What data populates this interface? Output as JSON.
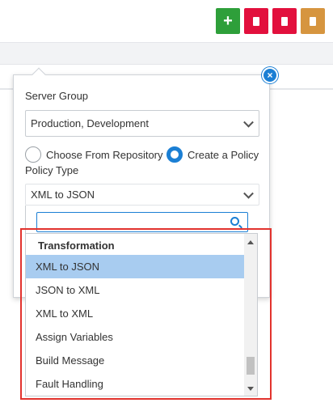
{
  "toolbar": {
    "buttons": [
      {
        "name": "add",
        "glyph": "+",
        "color": "#2e9f3a"
      },
      {
        "name": "delete",
        "color": "#e2103d"
      },
      {
        "name": "delete-2",
        "color": "#e2103d"
      },
      {
        "name": "note",
        "color": "#d6953f"
      }
    ]
  },
  "form": {
    "close_glyph": "×",
    "server_group_label": "Server Group",
    "server_group_value": "Production, Development",
    "radio_repo_label": "Choose From Repository",
    "radio_create_label": "Create a Policy",
    "policy_type_label": "Policy Type",
    "policy_type_value": "XML to JSON",
    "search_value": ""
  },
  "dropdown": {
    "group_label": "Transformation",
    "items": [
      "XML to JSON",
      "JSON to XML",
      "XML to XML",
      "Assign Variables",
      "Build Message",
      "Fault Handling"
    ],
    "selected": "XML to JSON"
  },
  "colors": {
    "accent": "#1b7fd4",
    "selected_bg": "#a8ccf0",
    "highlight": "#e2332e"
  }
}
